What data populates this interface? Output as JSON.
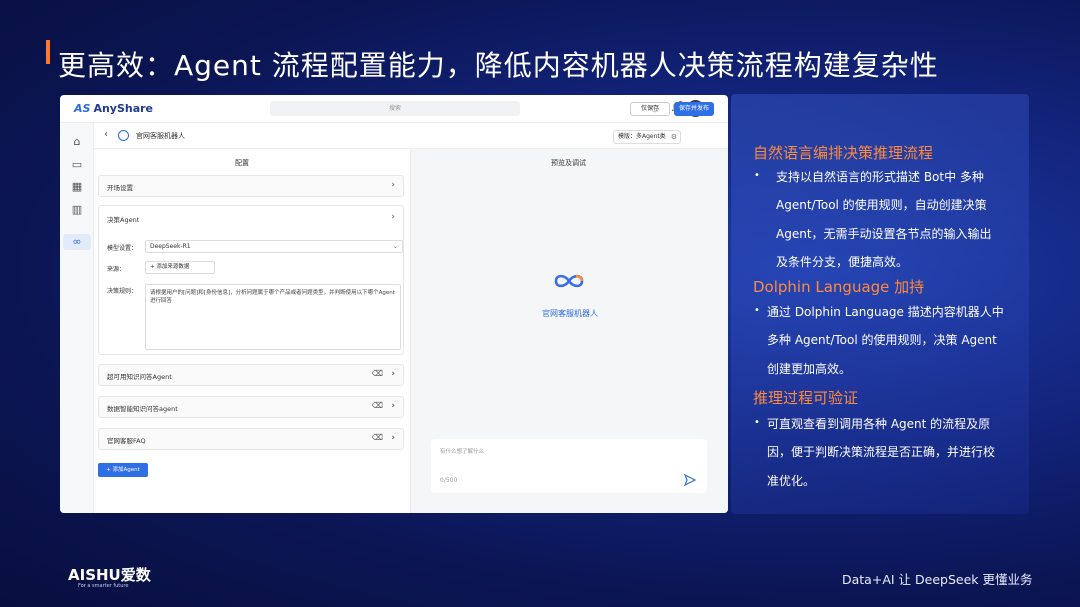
{
  "slide": {
    "title": "更高效：Agent 流程配置能力，降低内容机器人决策流程构建复杂性"
  },
  "app": {
    "logo_text": "AnyShare",
    "search_placeholder": "搜索",
    "bot_name": "官网客服机器人",
    "mode_label": "模版：多Agent类",
    "save_label": "仅保存",
    "publish_label": "保存并发布",
    "config_title": "配置",
    "preview_title": "预览及调试",
    "sections": {
      "opening": "开场设置",
      "decision": "决策Agent"
    },
    "decision": {
      "model_label": "模型设置：",
      "model_value": "DeepSeek-R1",
      "source_label": "来源：",
      "source_button": "+ 添加来源数据",
      "rule_label": "决策规则：",
      "rule_text": "请根据用户的[问题]和[身份信息]，分析问题属于哪个产品或者问题类型，并判断使用以下哪个Agent进行回答"
    },
    "agents": [
      "超可用知识问答Agent",
      "数据智能知识问答agent",
      "官网客服FAQ"
    ],
    "add_agent": "+ 添加Agent",
    "preview_bot_name": "官网客服机器人",
    "chat_placeholder": "有什么想了解什么",
    "chat_count": "0/500"
  },
  "panel": {
    "s1_title": "自然语言编排决策推理流程",
    "s1_lines": [
      "支持以自然语言的形式描述 Bot中 多种",
      "Agent/Tool 的使用规则，自动创建决策",
      "Agent，无需手动设置各节点的输入输出",
      "及条件分支，便捷高效。"
    ],
    "s2_title": "Dolphin Language 加持",
    "s2_lines": [
      "通过 Dolphin Language 描述内容机器人中",
      "多种 Agent/Tool 的使用规则，决策 Agent",
      "创建更加高效。"
    ],
    "s3_title": "推理过程可验证",
    "s3_lines": [
      "可直观查看到调用各种 Agent 的流程及原",
      "因，便于判断决策流程是否正确，并进行校",
      "准优化。"
    ],
    "bullet": "•"
  },
  "footer": {
    "brand": "AISHU爱数",
    "brand_sub": "For a smarter future",
    "tagline": "Data+AI 让 DeepSeek 更懂业务"
  },
  "colors": {
    "accent_orange": "#ff8a3d",
    "primary_blue": "#2f6fe6"
  }
}
